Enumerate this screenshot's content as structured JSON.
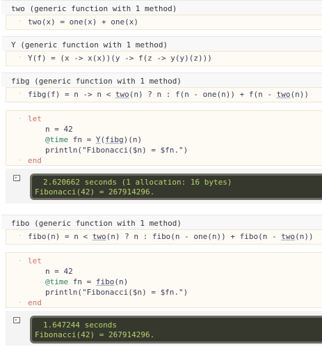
{
  "outputs": {
    "two": "two (generic function with 1 method)",
    "Y": "Y (generic function with 1 method)",
    "fibg": "fibg (generic function with 1 method)",
    "fibo": "fibo (generic function with 1 method)"
  },
  "code": {
    "two": {
      "name": "two",
      "rest": "(x) = one(x) + one(x)"
    },
    "Y": {
      "text": "Y(f) = (x -> x(x))(y -> f(z -> y(y)(z)))"
    },
    "fibg": {
      "pre": "fibg(f) = n -> n < ",
      "call1": "two",
      "mid": "(n) ? n : f(n - one(n)) + f(n - ",
      "call2": "two",
      "post": "(n))"
    },
    "fibo": {
      "pre": "fibo(n) = n < ",
      "call1": "two",
      "mid": "(n) ? n : fibo(n - one(n)) + fibo(n - ",
      "call2": "two",
      "post": "(n))"
    },
    "let1": {
      "kw_let": "let",
      "assign": "n = 42",
      "macro": "@time",
      "time_expr_pre": " fn = ",
      "time_fn": "Y",
      "time_paren1": "(",
      "time_arg": "fibg",
      "time_paren2": ")(n)",
      "println": "println(\"Fibonacci($n) = $fn.\")",
      "kw_end": "end"
    },
    "let2": {
      "kw_let": "let",
      "assign": "n = 42",
      "macro": "@time",
      "time_expr_pre": " fn = ",
      "time_fn": "fibo",
      "time_rest": "(n)",
      "println": "println(\"Fibonacci($n) = $fn.\")",
      "kw_end": "end"
    }
  },
  "terminal": {
    "run1": {
      "timing": "2.620662 seconds (1 allocation: 16 bytes)",
      "result": "Fibonacci(42) = 267914296."
    },
    "run2": {
      "timing": "1.647244 seconds",
      "result": "Fibonacci(42) = 267914296."
    }
  },
  "icons": {
    "bullet": "·",
    "terminal_icon": ">_"
  },
  "colors": {
    "keyword": "#d0706a",
    "macro": "#2f7f6f",
    "terminal_text": "#b3d46b",
    "terminal_bg": "#36382e"
  }
}
